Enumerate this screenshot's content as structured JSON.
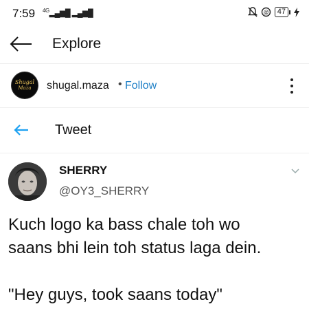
{
  "status_bar": {
    "time": "7:59",
    "network": "4G",
    "battery": "47"
  },
  "app_bar": {
    "title": "Explore",
    "back_icon": "arrow-left-icon"
  },
  "post": {
    "avatar_text_line1": "Shugal",
    "avatar_text_line2": "Maza",
    "username": "shugal.maza",
    "separator": "•",
    "follow_label": "Follow",
    "more_icon": "more-vertical-icon"
  },
  "tweet_header": {
    "title": "Tweet",
    "back_icon": "arrow-left-icon"
  },
  "tweet": {
    "name": "SHERRY",
    "handle": "@OY3_SHERRY",
    "line1": "Kuch logo ka bass chale toh wo",
    "line2": "saans bhi lein toh status laga dein.",
    "line3": "\"Hey guys, took saans today\""
  },
  "colors": {
    "accent": "#1d7fc6",
    "tweet_blue": "#1da1f2"
  }
}
